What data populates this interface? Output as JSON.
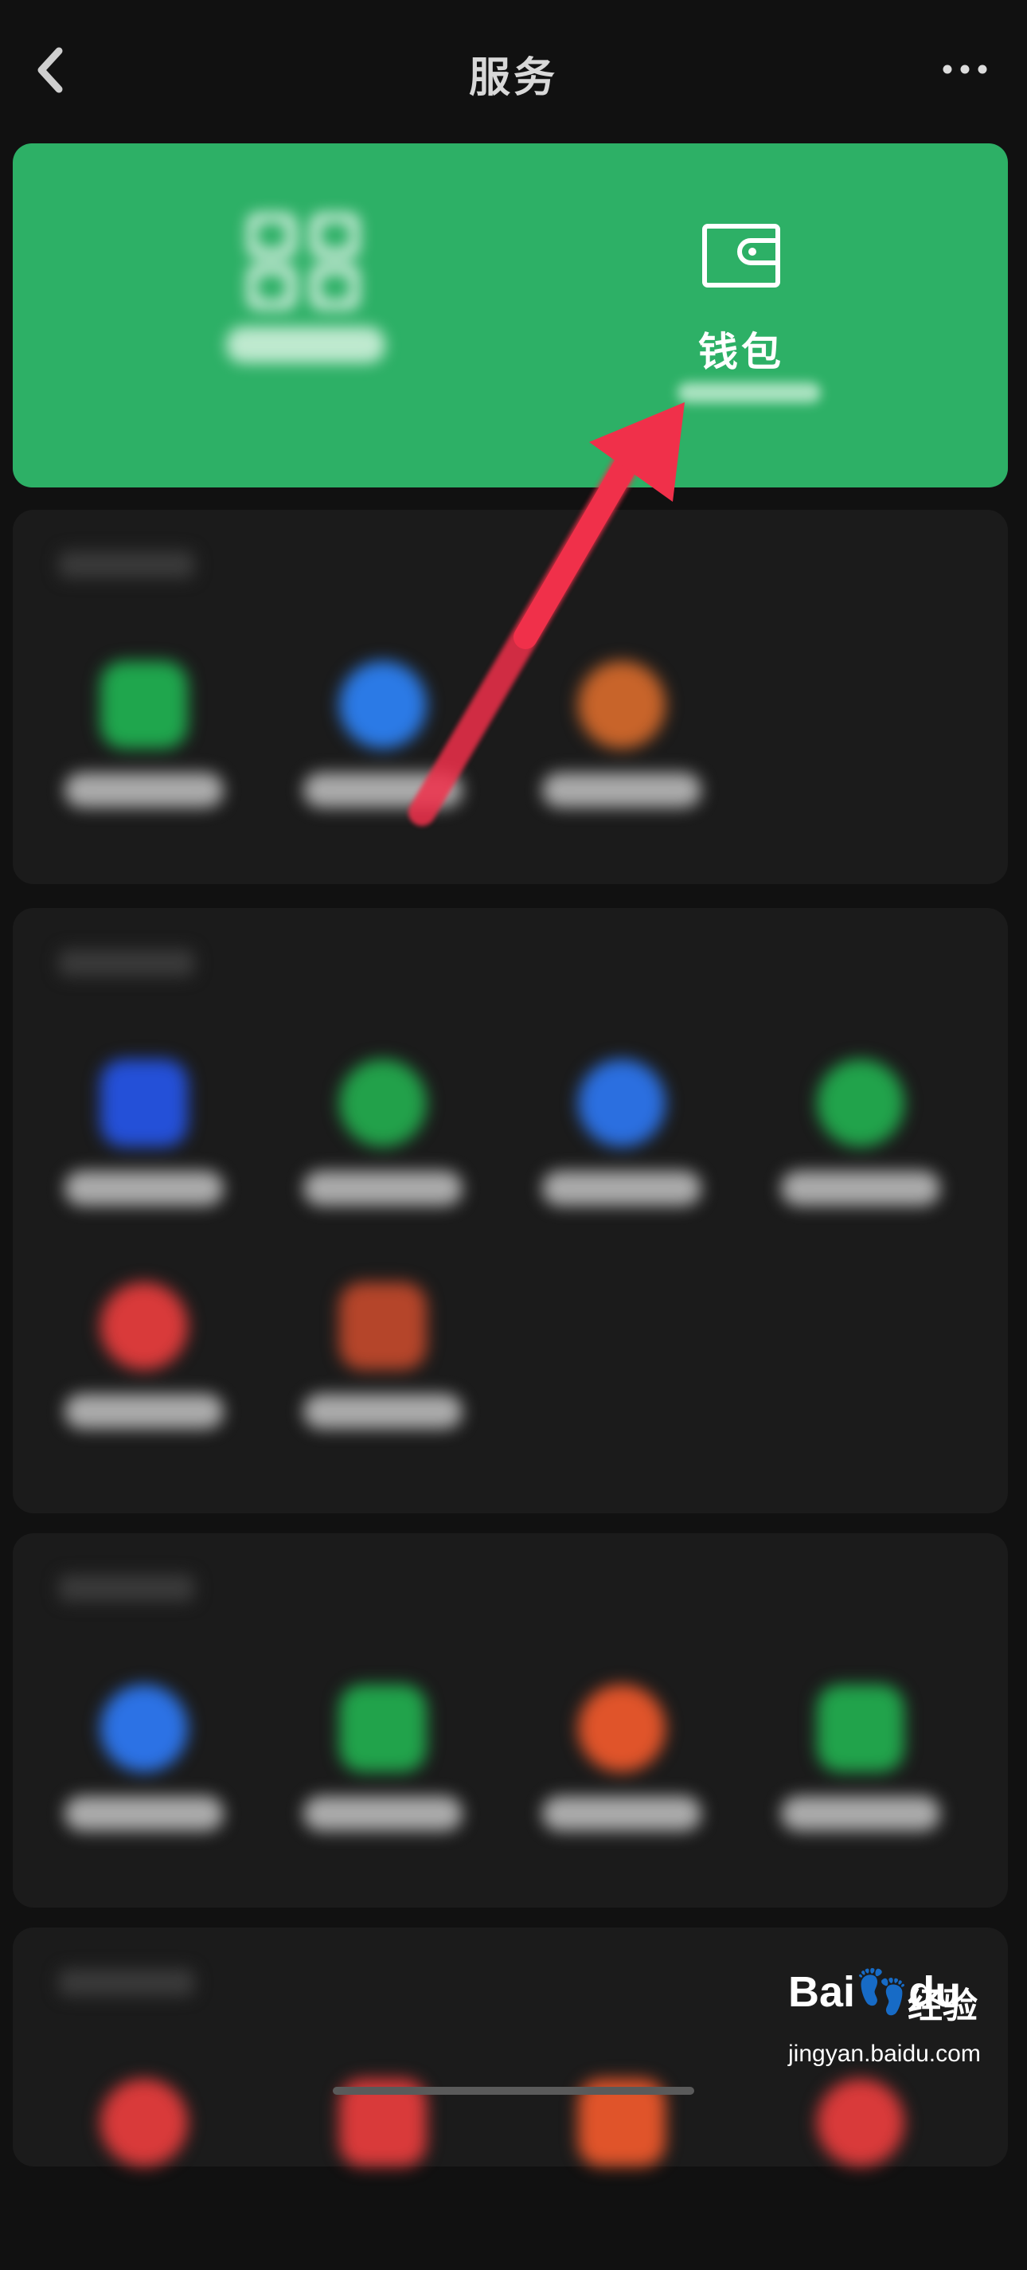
{
  "header": {
    "title": "服务",
    "back_icon": "chevron-left-icon",
    "more_icon": "more-dots-icon"
  },
  "hero": {
    "left_icon": "scan-pay-icon",
    "right_icon": "wallet-icon",
    "wallet_label": "钱包",
    "background": "#2db066"
  },
  "sections": [
    {
      "items": [
        {
          "icon_color": "#1fa64d"
        },
        {
          "icon_color": "#2b7ae6"
        },
        {
          "icon_color": "#c8642a"
        }
      ]
    },
    {
      "items": [
        {
          "icon_color": "#2450d8"
        },
        {
          "icon_color": "#22a14a"
        },
        {
          "icon_color": "#2b6fe0"
        },
        {
          "icon_color": "#21a34b"
        },
        {
          "icon_color": "#d93a3a"
        },
        {
          "icon_color": "#b5452a"
        }
      ]
    },
    {
      "items": [
        {
          "icon_color": "#2c72e5"
        },
        {
          "icon_color": "#21a34b"
        },
        {
          "icon_color": "#e0542a"
        },
        {
          "icon_color": "#21a34b"
        }
      ]
    },
    {
      "items": [
        {
          "icon_color": "#d93a3a"
        },
        {
          "icon_color": "#d93a3a"
        },
        {
          "icon_color": "#e0542a"
        },
        {
          "icon_color": "#d93a3a"
        }
      ]
    }
  ],
  "annotation": {
    "arrow_color": "#f0304a"
  },
  "watermark": {
    "logo": "Bai👣du",
    "text": "经验",
    "url": "jingyan.baidu.com"
  }
}
